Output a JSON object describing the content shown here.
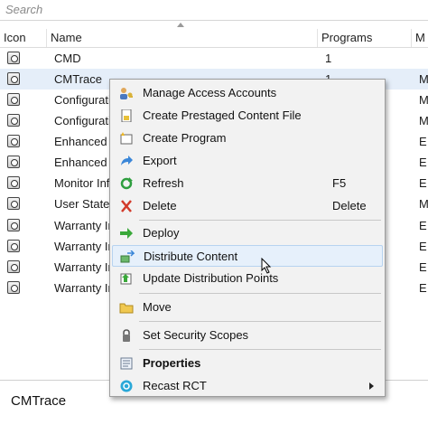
{
  "search": {
    "placeholder": "Search"
  },
  "columns": [
    "Icon",
    "Name",
    "Programs",
    "M"
  ],
  "rows": [
    {
      "name": "CMD",
      "programs": "1",
      "m": ""
    },
    {
      "name": "CMTrace",
      "programs": "1",
      "m": "M"
    },
    {
      "name": "Configurati",
      "programs": "",
      "m": "M"
    },
    {
      "name": "Configurati",
      "programs": "",
      "m": "M"
    },
    {
      "name": "Enhanced V",
      "programs": "",
      "m": "E"
    },
    {
      "name": "Enhanced V",
      "programs": "",
      "m": "E"
    },
    {
      "name": "Monitor Inf",
      "programs": "",
      "m": "E"
    },
    {
      "name": "User State",
      "programs": "",
      "m": "M"
    },
    {
      "name": "Warranty In",
      "programs": "",
      "m": "E"
    },
    {
      "name": "Warranty In",
      "programs": "",
      "m": "E"
    },
    {
      "name": "Warranty In",
      "programs": "",
      "m": "E"
    },
    {
      "name": "Warranty In",
      "programs": "",
      "m": "E"
    }
  ],
  "details": {
    "title": "CMTrace",
    "subtitle": ""
  },
  "menu": {
    "items": [
      {
        "label": "Manage Access Accounts",
        "shortcut": "",
        "icon": "users-key-icon"
      },
      {
        "label": "Create Prestaged Content File",
        "shortcut": "",
        "icon": "prestaged-file-icon"
      },
      {
        "label": "Create Program",
        "shortcut": "",
        "icon": "create-program-icon"
      },
      {
        "label": "Export",
        "shortcut": "",
        "icon": "export-arrow-icon"
      },
      {
        "label": "Refresh",
        "shortcut": "F5",
        "icon": "refresh-icon"
      },
      {
        "label": "Delete",
        "shortcut": "Delete",
        "icon": "delete-x-icon"
      },
      {
        "label": "Deploy",
        "shortcut": "",
        "icon": "deploy-arrow-icon"
      },
      {
        "label": "Distribute Content",
        "shortcut": "",
        "icon": "distribute-content-icon"
      },
      {
        "label": "Update Distribution Points",
        "shortcut": "",
        "icon": "update-dp-icon"
      },
      {
        "label": "Move",
        "shortcut": "",
        "icon": "folder-move-icon"
      },
      {
        "label": "Set Security Scopes",
        "shortcut": "",
        "icon": "lock-icon"
      },
      {
        "label": "Properties",
        "shortcut": "",
        "icon": "properties-icon"
      },
      {
        "label": "Recast RCT",
        "shortcut": "",
        "icon": "recast-icon"
      }
    ]
  },
  "colors": {
    "hover_bg": "#e6f0fb",
    "hover_border": "#b7d3f0",
    "selected_row": "#e5eef9",
    "menu_bg": "#f2f2f2"
  }
}
